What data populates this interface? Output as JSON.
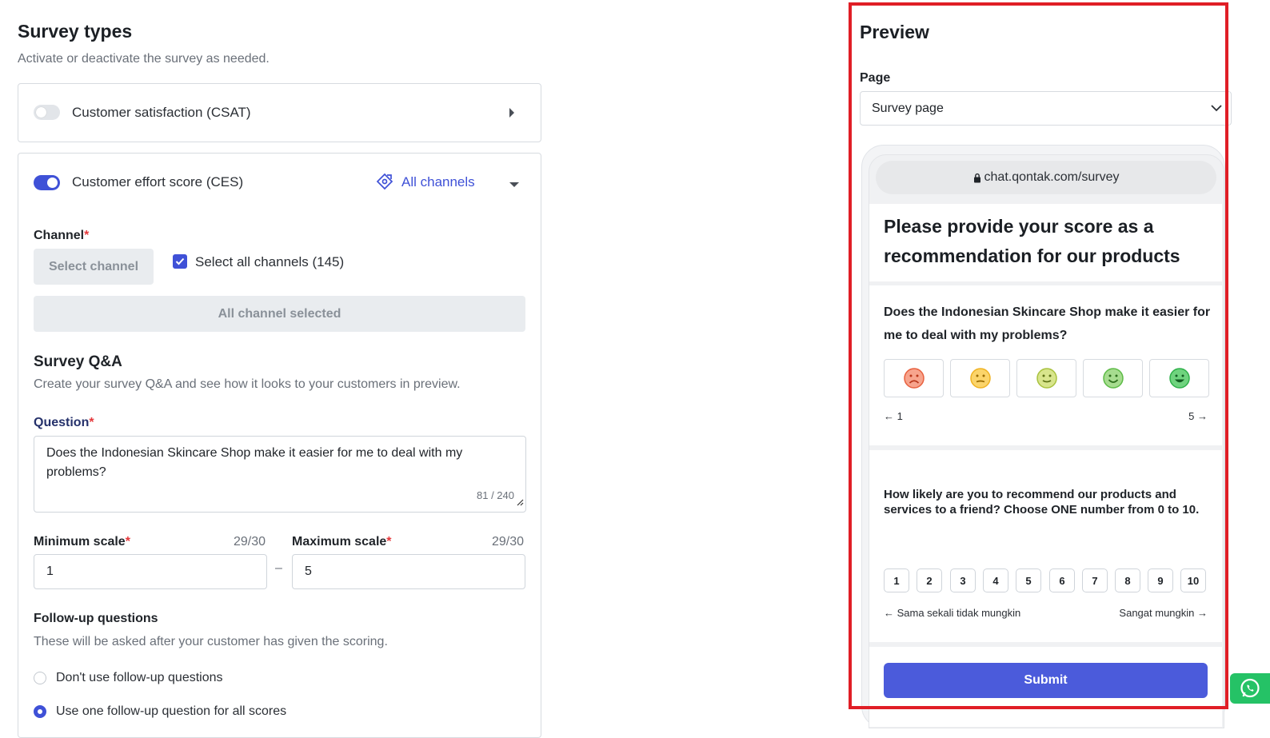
{
  "header": {
    "title": "Survey types",
    "subtitle": "Activate or deactivate the survey as needed."
  },
  "csat": {
    "label": "Customer satisfaction (CSAT)",
    "enabled": false
  },
  "ces": {
    "label": "Customer effort score (CES)",
    "enabled": true,
    "channels_link": "All channels",
    "channel_label": "Channel",
    "select_channel_button": "Select channel",
    "select_all_label": "Select all channels (145)",
    "select_all_checked": true,
    "all_selected_button": "All channel selected",
    "qa_title": "Survey Q&A",
    "qa_subtitle": "Create your survey Q&A and see how it looks to your customers in preview.",
    "question_label": "Question",
    "question_value": "Does the Indonesian Skincare Shop make it easier for me to deal with my problems?",
    "question_counter": "81 / 240",
    "min_label": "Minimum scale",
    "min_counter": "29/30",
    "min_value": "1",
    "range_dash": "–",
    "max_label": "Maximum scale",
    "max_counter": "29/30",
    "max_value": "5",
    "followup_title": "Follow-up questions",
    "followup_subtitle": "These will be asked after your customer has given the scoring.",
    "followup_options": [
      {
        "label": "Don't use follow-up questions",
        "selected": false
      },
      {
        "label": "Use one follow-up question for all scores",
        "selected": true
      }
    ]
  },
  "preview": {
    "title": "Preview",
    "page_label": "Page",
    "page_value": "Survey page",
    "url": "chat.qontak.com/survey",
    "heading": "Please provide your score as a recommendation for our products",
    "ces_question": "Does the Indonesian Skincare Shop make it easier for me to deal with my problems?",
    "ces_faces": [
      {
        "icon": "very-sad-face-icon",
        "color": "#e8613f"
      },
      {
        "icon": "neutral-face-icon",
        "color": "#f0b323"
      },
      {
        "icon": "slight-smile-face-icon",
        "color": "#a9c23f"
      },
      {
        "icon": "smile-face-icon",
        "color": "#5dbb46"
      },
      {
        "icon": "big-smile-face-icon",
        "color": "#2fb14a"
      }
    ],
    "ces_min_label": "← 1",
    "ces_max_label": "5 →",
    "nps_question": "How likely are you to recommend our products and services to a friend? Choose ONE number from 0 to 10.",
    "nps_numbers": [
      "1",
      "2",
      "3",
      "4",
      "5",
      "6",
      "7",
      "8",
      "9",
      "10"
    ],
    "nps_min_label": "← Sama sekali tidak mungkin",
    "nps_max_label": "Sangat mungkin →",
    "submit": "Submit"
  },
  "colors": {
    "accent": "#3f51d7",
    "submit": "#4b5bdb",
    "highlight_frame": "#e01e26",
    "whatsapp": "#25c266"
  }
}
